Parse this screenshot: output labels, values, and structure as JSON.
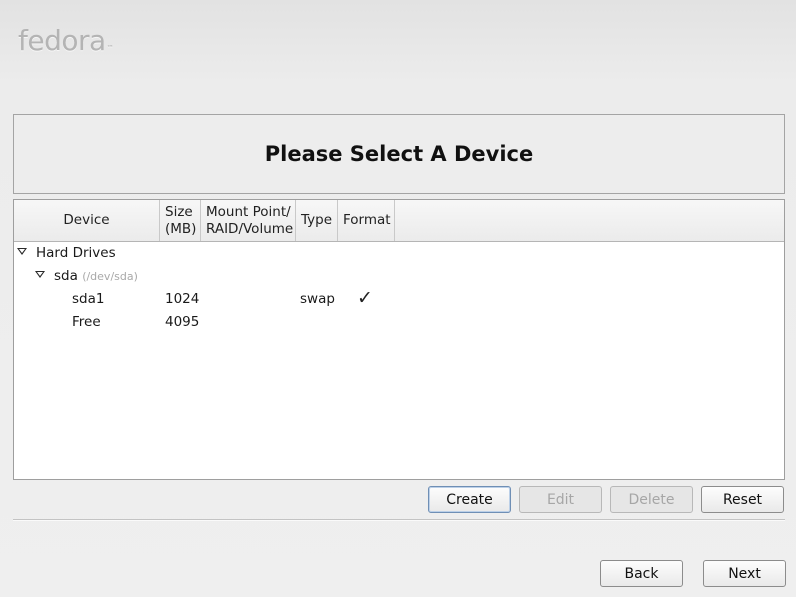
{
  "brand": {
    "logo_text": "fedora",
    "tm": "™"
  },
  "header": {
    "title": "Please Select A Device"
  },
  "table": {
    "columns": {
      "device": "Device",
      "size_line1": "Size",
      "size_line2": "(MB)",
      "mount_line1": "Mount Point/",
      "mount_line2": "RAID/Volume",
      "type": "Type",
      "format": "Format"
    },
    "rows": [
      {
        "device": "Hard Drives",
        "size": "",
        "type": "",
        "format": ""
      },
      {
        "device": "sda",
        "path": "(/dev/sda)",
        "size": "",
        "type": "",
        "format": ""
      },
      {
        "device": "sda1",
        "size": "1024",
        "type": "swap",
        "format": "✓"
      },
      {
        "device": "Free",
        "size": "4095",
        "type": "",
        "format": ""
      }
    ]
  },
  "actions": {
    "create": "Create",
    "edit": "Edit",
    "delete": "Delete",
    "reset": "Reset"
  },
  "nav": {
    "back": "Back",
    "next": "Next"
  },
  "colors": {
    "accent_focus": "#6f8fb5",
    "disabled_text": "#a6a6a6"
  }
}
